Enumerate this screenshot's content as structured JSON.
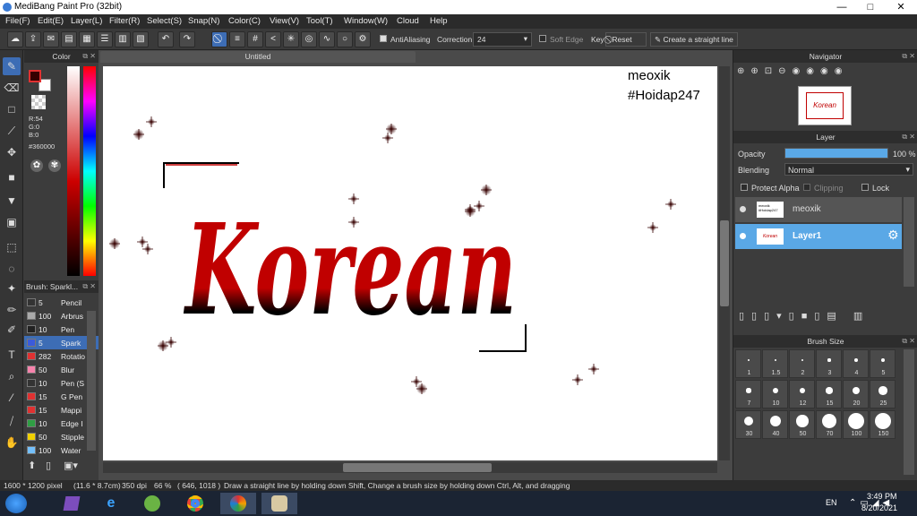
{
  "window": {
    "title": "MediBang Paint Pro (32bit)",
    "controls": [
      "—",
      "□",
      "✕"
    ]
  },
  "menu": [
    "File(F)",
    "Edit(E)",
    "Layer(L)",
    "Filter(R)",
    "Select(S)",
    "Snap(N)",
    "Color(C)",
    "View(V)",
    "Tool(T)",
    "Window(W)",
    "Cloud",
    "Help"
  ],
  "toolbar": {
    "antialiasing_label": "AntiAliasing",
    "correction_label": "Correction",
    "correction_value": "24",
    "soft_edge_label": "Soft Edge",
    "key_label": "Key",
    "reset_label": "Reset",
    "straight_line_label": "Create a straight line"
  },
  "color_panel": {
    "title": "Color",
    "r": "R:54",
    "g": "G:0",
    "b": "B:0",
    "hex": "#360000",
    "foreground": "#360000",
    "background": "#ffffff"
  },
  "brush_panel": {
    "title": "Brush: Sparkl...",
    "items": [
      {
        "size": "5",
        "name": "Pencil",
        "color": "#333333"
      },
      {
        "size": "100",
        "name": "Arbrus",
        "color": "#aaaaaa"
      },
      {
        "size": "10",
        "name": "Pen",
        "color": "#222222"
      },
      {
        "size": "5",
        "name": "Spark",
        "color": "#3b5bdb",
        "selected": true
      },
      {
        "size": "282",
        "name": "Rotatio",
        "color": "#e03131"
      },
      {
        "size": "50",
        "name": "Blur",
        "color": "#f783ac"
      },
      {
        "size": "10",
        "name": "Pen (S",
        "color": "#333333"
      },
      {
        "size": "15",
        "name": "G Pen",
        "color": "#e03131"
      },
      {
        "size": "15",
        "name": "Mappi",
        "color": "#e03131"
      },
      {
        "size": "10",
        "name": "Edge I",
        "color": "#2f9e44"
      },
      {
        "size": "50",
        "name": "Stipple",
        "color": "#f0d000"
      },
      {
        "size": "100",
        "name": "Water",
        "color": "#74c0fc"
      }
    ]
  },
  "document": {
    "tab": "Untitled",
    "canvas_text_1": "meoxik",
    "canvas_text_2": "#Hoidap247",
    "artwork_word": "Korean",
    "artwork_colors": {
      "top": "#c00000",
      "bottom": "#000000"
    }
  },
  "navigator": {
    "title": "Navigator",
    "thumb_text": "Korean"
  },
  "layer_panel": {
    "title": "Layer",
    "opacity_label": "Opacity",
    "opacity_value": "100 %",
    "opacity": 1.0,
    "blending_label": "Blending",
    "blending_value": "Normal",
    "protect_alpha": "Protect Alpha",
    "clipping": "Clipping",
    "lock": "Lock",
    "layers": [
      {
        "name": "meoxik",
        "thumb_text": "meoxik\n#Hoidap247",
        "selected": false
      },
      {
        "name": "Layer1",
        "thumb_text": "Korean",
        "selected": true
      }
    ]
  },
  "brush_size_panel": {
    "title": "Brush Size",
    "sizes": [
      "1",
      "1.5",
      "2",
      "3",
      "4",
      "5",
      "7",
      "10",
      "12",
      "15",
      "20",
      "25",
      "30",
      "40",
      "50",
      "70",
      "100",
      "150"
    ]
  },
  "status": {
    "size": "1600 * 1200 pixel",
    "cm": "(11.6 * 8.7cm)",
    "dpi": "350 dpi",
    "zoom": "66 %",
    "coords": "( 646, 1018 )",
    "hint": "Draw a straight line by holding down Shift, Change a brush size by holding down Ctrl, Alt, and dragging"
  },
  "taskbar": {
    "lang": "EN",
    "time": "3:49 PM",
    "date": "8/20/2021"
  }
}
